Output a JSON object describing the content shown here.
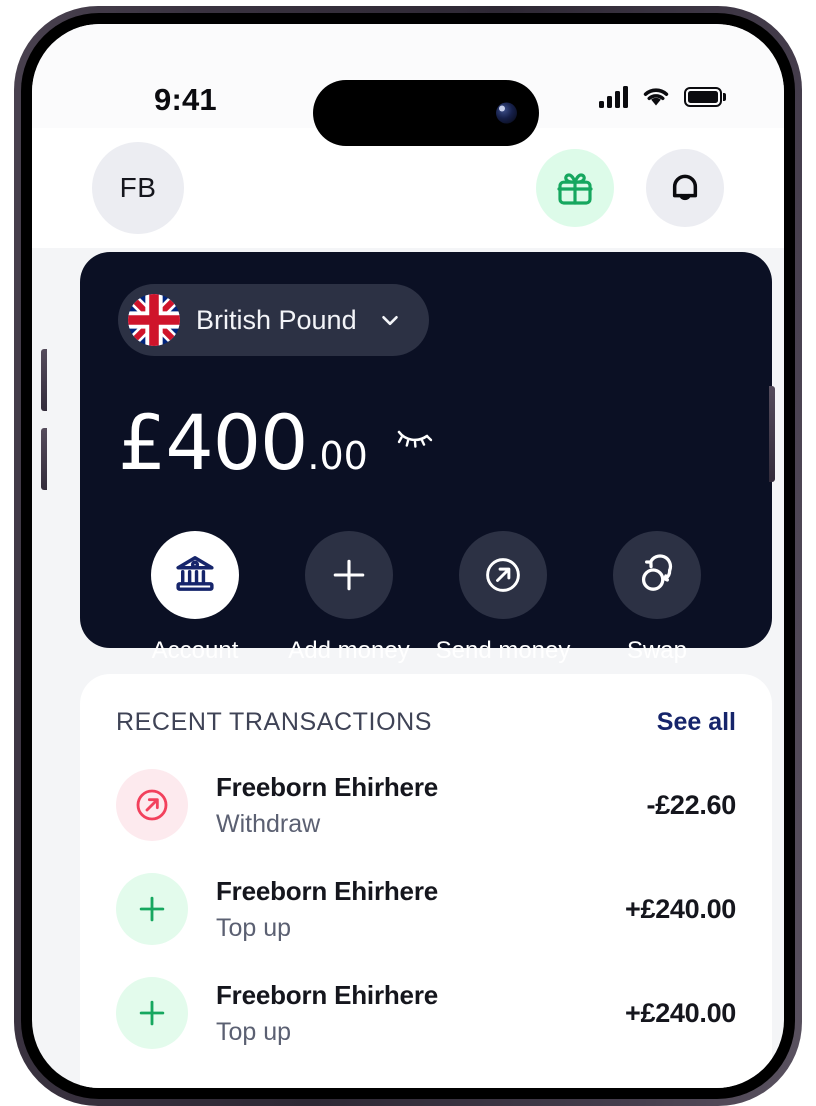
{
  "status_bar": {
    "time": "9:41",
    "cellular_icon": "cellular-bars-icon",
    "wifi_icon": "wifi-icon",
    "battery_icon": "battery-full-icon"
  },
  "header": {
    "avatar_initials": "FB",
    "rewards_icon": "gift-icon",
    "notifications_icon": "bell-icon"
  },
  "balance_card": {
    "currency": {
      "flag_icon": "uk-flag-icon",
      "label": "British Pound",
      "chevron_icon": "chevron-down-icon"
    },
    "amount_main": "£400",
    "amount_cents": ".00",
    "visibility_icon": "eye-closed-icon",
    "actions": [
      {
        "label": "Account",
        "icon": "bank-icon",
        "style": "light"
      },
      {
        "label": "Add money",
        "icon": "plus-icon",
        "style": "dark"
      },
      {
        "label": "Send money",
        "icon": "arrow-up-right-circle-icon",
        "style": "dark"
      },
      {
        "label": "Swap",
        "icon": "swap-circles-icon",
        "style": "dark"
      }
    ]
  },
  "transactions": {
    "title": "RECENT TRANSACTIONS",
    "see_all_label": "See all",
    "items": [
      {
        "name": "Freeborn Ehirhere",
        "type": "Withdraw",
        "amount": "-£22.60",
        "direction": "debit",
        "icon": "arrow-up-right-circle-icon"
      },
      {
        "name": "Freeborn Ehirhere",
        "type": "Top up",
        "amount": "+£240.00",
        "direction": "credit",
        "icon": "plus-icon"
      },
      {
        "name": "Freeborn Ehirhere",
        "type": "Top up",
        "amount": "+£240.00",
        "direction": "credit",
        "icon": "plus-icon"
      }
    ]
  },
  "colors": {
    "card_dark": "#0b1024",
    "page_bg": "#f4f5f7",
    "accent_green": "#16a75f",
    "accent_red": "#f2415c",
    "link_navy": "#16256b",
    "bank_navy": "#16256b"
  }
}
